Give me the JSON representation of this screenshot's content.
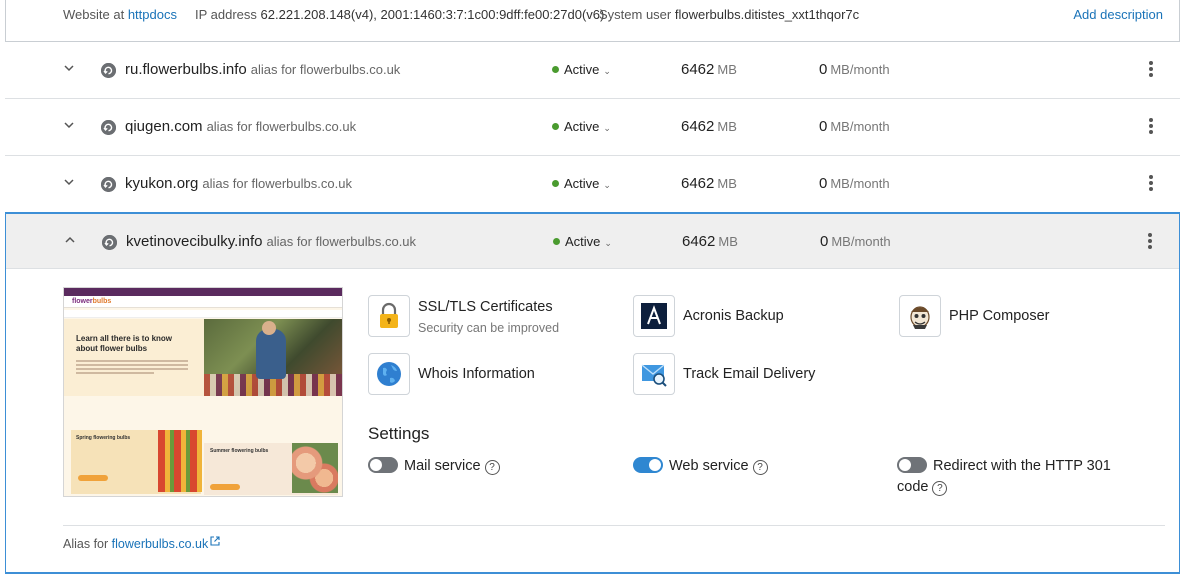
{
  "top": {
    "website_prefix": "Website at",
    "website_link": "httpdocs",
    "ip_prefix": "IP address",
    "ip_value": "62.221.208.148(v4), 2001:1460:3:7:1c00:9dff:fe00:27d0(v6)",
    "sysuser_prefix": "System user",
    "sysuser_value": "flowerbulbs.ditistes_xxt1thqor7c",
    "add_description": "Add description"
  },
  "rows": [
    {
      "domain": "ru.flowerbulbs.info",
      "alias": "alias for flowerbulbs.co.uk",
      "status": "Active",
      "disk_value": "6462",
      "disk_unit": "MB",
      "traffic_value": "0",
      "traffic_unit": "MB/month"
    },
    {
      "domain": "qiugen.com",
      "alias": "alias for flowerbulbs.co.uk",
      "status": "Active",
      "disk_value": "6462",
      "disk_unit": "MB",
      "traffic_value": "0",
      "traffic_unit": "MB/month"
    },
    {
      "domain": "kyukon.org",
      "alias": "alias for flowerbulbs.co.uk",
      "status": "Active",
      "disk_value": "6462",
      "disk_unit": "MB",
      "traffic_value": "0",
      "traffic_unit": "MB/month"
    },
    {
      "domain": "kvetinovecibulky.info",
      "alias": "alias for flowerbulbs.co.uk",
      "status": "Active",
      "disk_value": "6462",
      "disk_unit": "MB",
      "traffic_value": "0",
      "traffic_unit": "MB/month"
    }
  ],
  "preview": {
    "logo_a": "flower",
    "logo_b": "bulbs",
    "hero_title": "Learn all there is to know about flower bulbs",
    "card1_title": "Spring flowering bulbs",
    "card2_title": "Summer flowering bulbs"
  },
  "tools": {
    "ssl_title": "SSL/TLS Certificates",
    "ssl_sub": "Security can be improved",
    "acronis_title": "Acronis Backup",
    "php_title": "PHP Composer",
    "whois_title": "Whois Information",
    "track_title": "Track Email Delivery"
  },
  "settings": {
    "heading": "Settings",
    "mail_label": "Mail service",
    "web_label": "Web service",
    "redirect_label_1": "Redirect with the HTTP 301",
    "redirect_label_2": "code",
    "help_glyph": "?"
  },
  "footer": {
    "alias_prefix": "Alias for",
    "alias_link": "flowerbulbs.co.uk"
  },
  "colors": {
    "accent": "#2f87d1",
    "link": "#1a73b8",
    "active_dot": "#4a9b2f"
  }
}
